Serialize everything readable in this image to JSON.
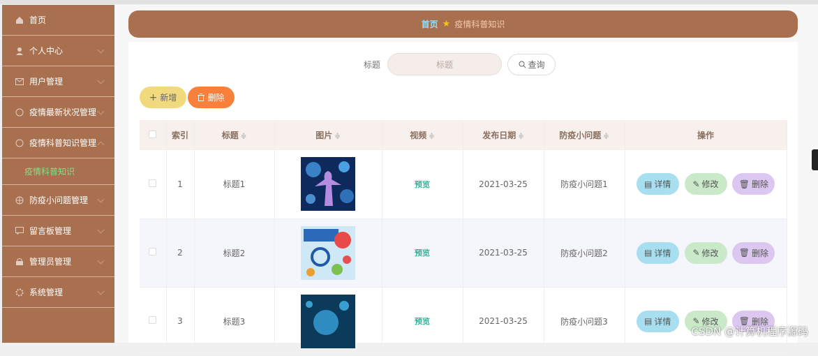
{
  "sidebar": {
    "items": [
      {
        "label": "首页"
      },
      {
        "label": "个人中心"
      },
      {
        "label": "用户管理"
      },
      {
        "label": "疫情最新状况管理"
      },
      {
        "label": "疫情科普知识管理"
      },
      {
        "label": "防疫小问题管理"
      },
      {
        "label": "留言板管理"
      },
      {
        "label": "管理员管理"
      },
      {
        "label": "系统管理"
      }
    ],
    "sub_item": "疫情科普知识"
  },
  "breadcrumb": {
    "home": "首页",
    "current": "疫情科普知识"
  },
  "search": {
    "label": "标题",
    "placeholder": "标题",
    "button": "查询"
  },
  "actions": {
    "add": "新增",
    "delete": "删除"
  },
  "table": {
    "headers": [
      "索引",
      "标题",
      "图片",
      "视频",
      "发布日期",
      "防疫小问题",
      "操作"
    ],
    "rows": [
      {
        "index": "1",
        "title": "标题1",
        "video": "预览",
        "date": "2021-03-25",
        "question": "防疫小问题1"
      },
      {
        "index": "2",
        "title": "标题2",
        "video": "预览",
        "date": "2021-03-25",
        "question": "防疫小问题2"
      },
      {
        "index": "3",
        "title": "标题3",
        "video": "预览",
        "date": "2021-03-25",
        "question": "防疫小问题3"
      }
    ],
    "ops": {
      "view": "详情",
      "edit": "修改",
      "delete": "删除"
    }
  },
  "watermark": "CSDN @计算机程序源码",
  "colors": {
    "sidebar": "#a9704f",
    "add_button": "#f1da7e",
    "delete_button": "#f7813b",
    "view_op": "#a8dff0",
    "edit_op": "#c9e9c9",
    "delete_op": "#dcc7f0"
  }
}
